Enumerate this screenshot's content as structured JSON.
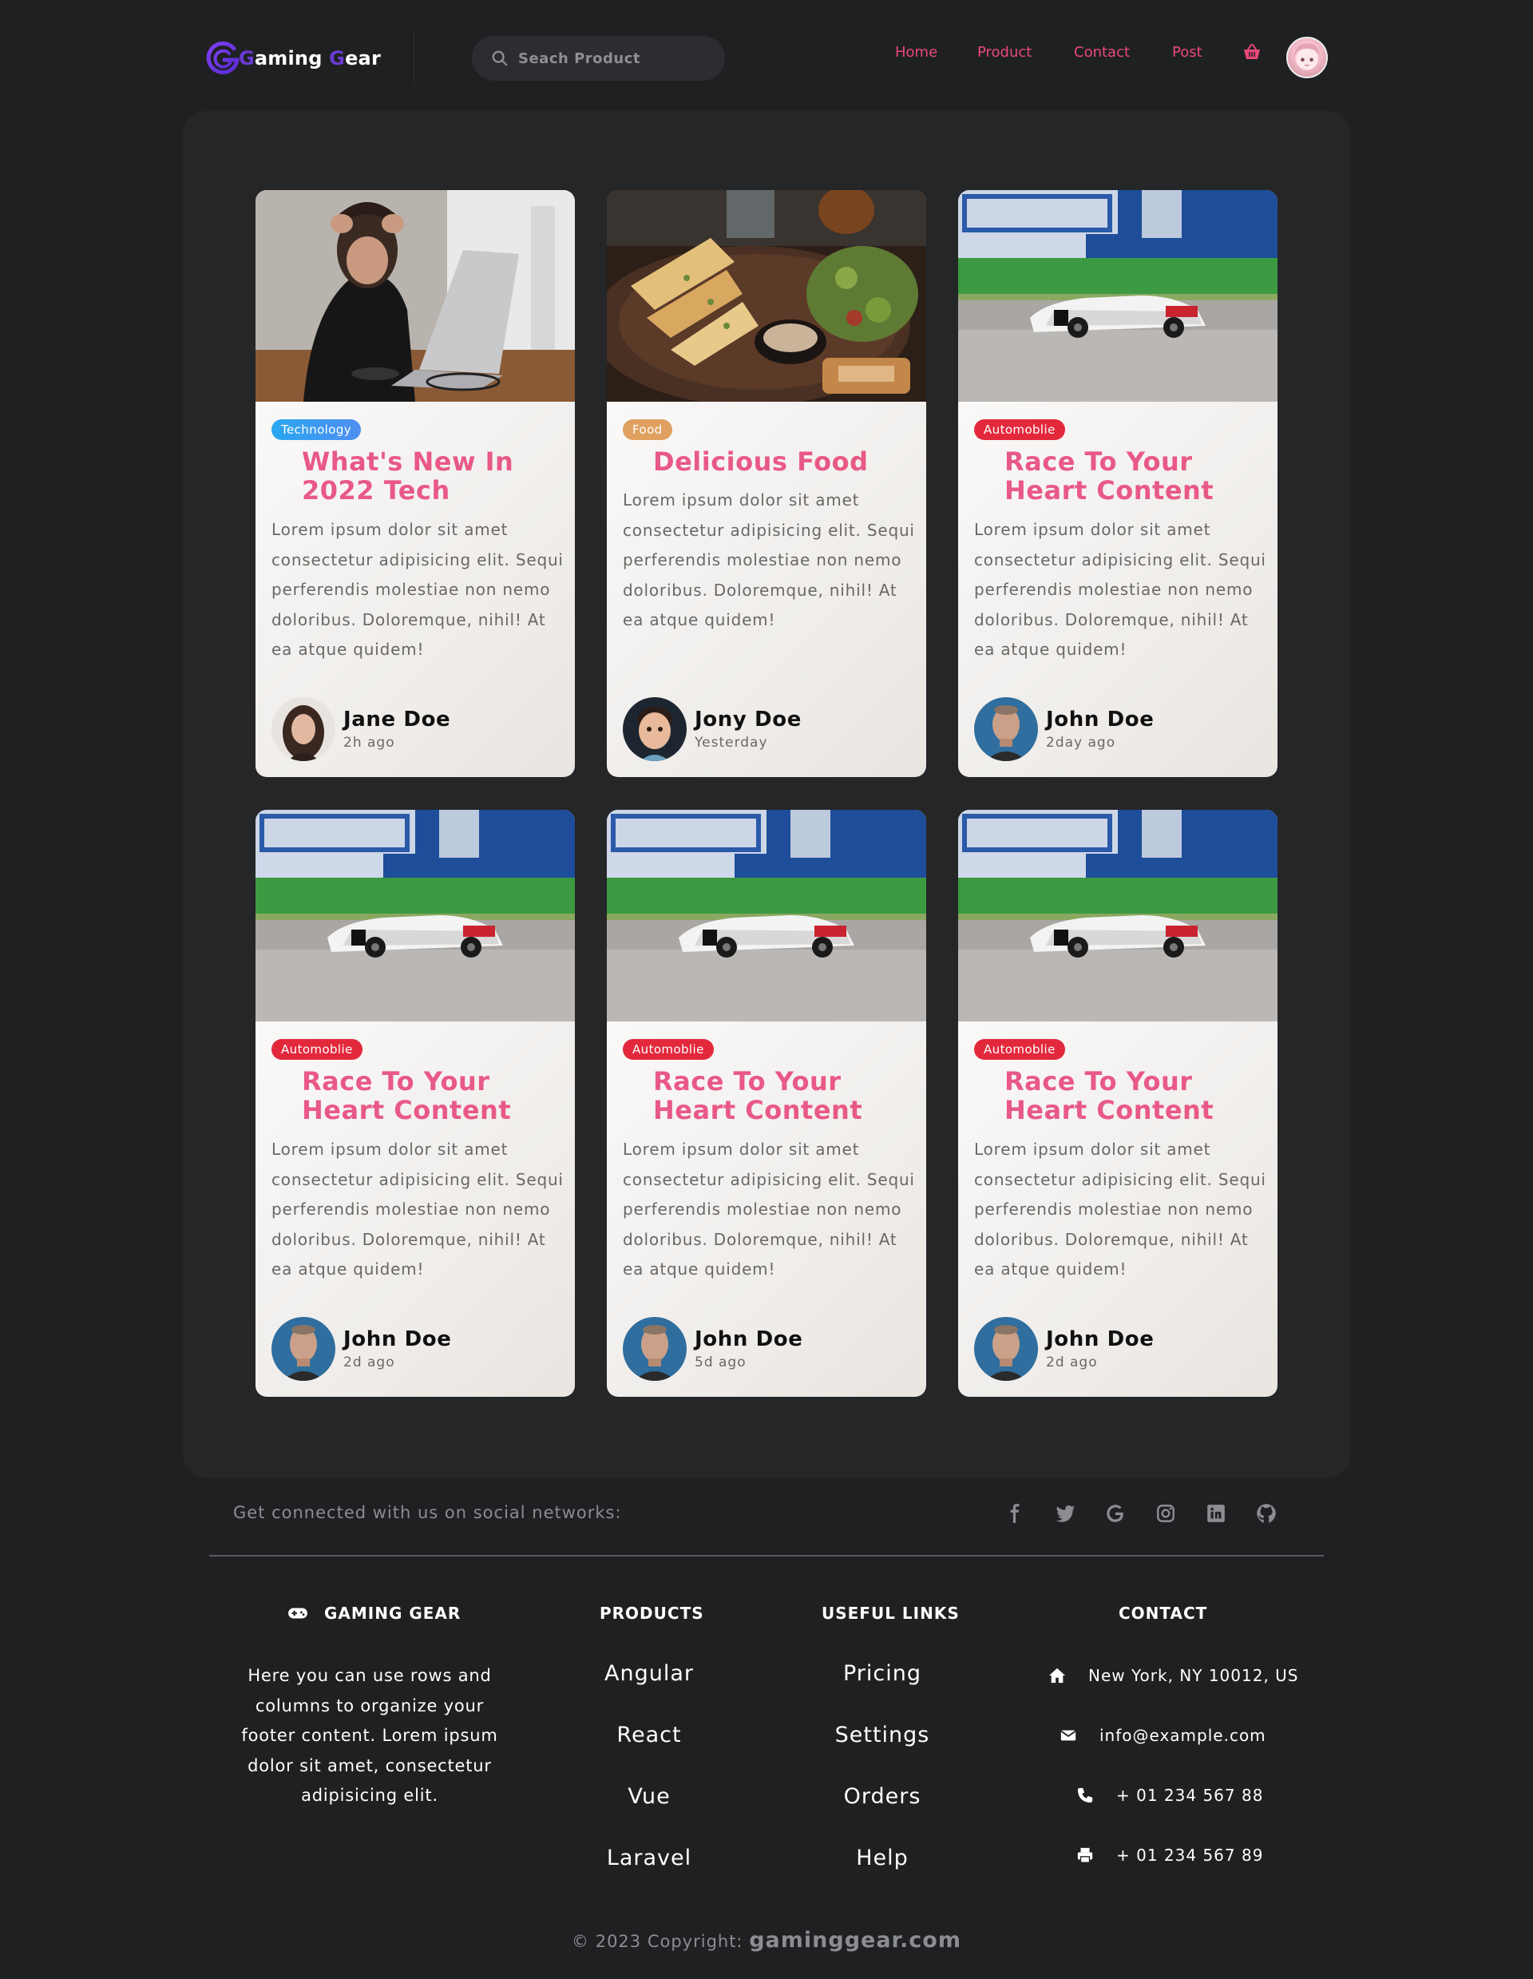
{
  "nav": {
    "logo_g": "G",
    "logo_rest": "aming ",
    "logo_g2": "G",
    "logo_rest2": "ear",
    "search_placeholder": "Seach Product",
    "links": [
      "Home",
      "Product",
      "Contact",
      "Post"
    ],
    "accent": "#e8497a"
  },
  "cards": [
    {
      "badge": "Technology",
      "title": "What's New In 2022 Tech",
      "body": "Lorem ipsum dolor sit amet consectetur adipisicing elit. Sequi perferendis molestiae non nemo doloribus. Doloremque, nihil! At ea atque quidem!",
      "author": "Jane Doe",
      "time": "2h ago"
    },
    {
      "badge": "Food",
      "title": "Delicious Food",
      "body": "Lorem ipsum dolor sit amet consectetur adipisicing elit. Sequi perferendis molestiae non nemo doloribus. Doloremque, nihil! At ea atque quidem!",
      "author": "Jony Doe",
      "time": "Yesterday"
    },
    {
      "badge": "Automoblie",
      "title": "Race To Your Heart Content",
      "body": "Lorem ipsum dolor sit amet consectetur adipisicing elit. Sequi perferendis molestiae non nemo doloribus. Doloremque, nihil! At ea atque quidem!",
      "author": "John Doe",
      "time": "2day ago"
    },
    {
      "badge": "Automoblie",
      "title": "Race To Your Heart Content",
      "body": "Lorem ipsum dolor sit amet consectetur adipisicing elit. Sequi perferendis molestiae non nemo doloribus. Doloremque, nihil! At ea atque quidem!",
      "author": "John Doe",
      "time": "2d ago"
    },
    {
      "badge": "Automoblie",
      "title": "Race To Your Heart Content",
      "body": "Lorem ipsum dolor sit amet consectetur adipisicing elit. Sequi perferendis molestiae non nemo doloribus. Doloremque, nihil! At ea atque quidem!",
      "author": "John Doe",
      "time": "5d ago"
    },
    {
      "badge": "Automoblie",
      "title": "Race To Your Heart Content",
      "body": "Lorem ipsum dolor sit amet consectetur adipisicing elit. Sequi perferendis molestiae non nemo doloribus. Doloremque, nihil! At ea atque quidem!",
      "author": "John Doe",
      "time": "2d ago"
    }
  ],
  "footer": {
    "social_text": "Get connected with us on social networks:",
    "brand": "GAMING GEAR",
    "about": "Here you can use rows and columns to organize your footer content. Lorem ipsum dolor sit amet, consectetur adipisicing elit.",
    "products_heading": "PRODUCTS",
    "products": [
      "Angular",
      "React",
      "Vue",
      "Laravel"
    ],
    "useful_heading": "USEFUL LINKS",
    "useful": [
      "Pricing",
      "Settings",
      "Orders",
      "Help"
    ],
    "contact_heading": "CONTACT",
    "contact": [
      "New York, NY 10012, US",
      "info@example.com",
      "+ 01 234 567 88",
      "+ 01 234 567 89"
    ],
    "copyright": "© 2023 Copyright:",
    "site": "gaminggear.com"
  }
}
